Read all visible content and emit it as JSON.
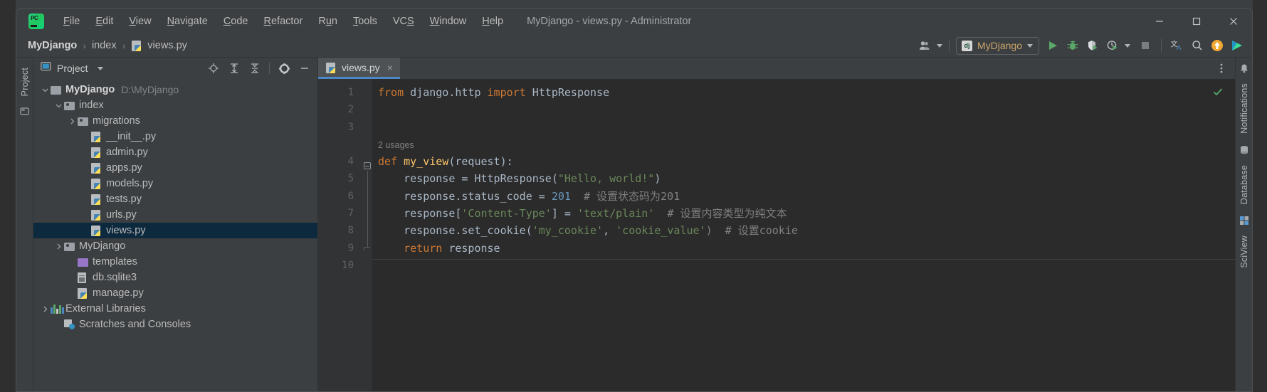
{
  "window": {
    "title": "MyDjango - views.py - Administrator",
    "app_icon": "pycharm-logo",
    "controls": [
      {
        "name": "minimize-button",
        "glyph": "minimize-icon"
      },
      {
        "name": "maximize-button",
        "glyph": "maximize-icon"
      },
      {
        "name": "close-button",
        "glyph": "close-icon"
      }
    ]
  },
  "menu": [
    {
      "label": "File",
      "mnemonic": "F"
    },
    {
      "label": "Edit",
      "mnemonic": "E"
    },
    {
      "label": "View",
      "mnemonic": "V"
    },
    {
      "label": "Navigate",
      "mnemonic": "N"
    },
    {
      "label": "Code",
      "mnemonic": "C"
    },
    {
      "label": "Refactor",
      "mnemonic": "R"
    },
    {
      "label": "Run",
      "mnemonic": "u"
    },
    {
      "label": "Tools",
      "mnemonic": "T"
    },
    {
      "label": "VCS",
      "mnemonic": "S"
    },
    {
      "label": "Window",
      "mnemonic": "W"
    },
    {
      "label": "Help",
      "mnemonic": "H"
    }
  ],
  "breadcrumb": {
    "items": [
      {
        "label": "MyDjango",
        "icon": null,
        "root": true
      },
      {
        "label": "index",
        "icon": null,
        "root": false
      },
      {
        "label": "views.py",
        "icon": "python-file-icon",
        "root": false
      }
    ],
    "separator": "›"
  },
  "toolbar": {
    "collaborate_icon": "user-group-icon",
    "run_config": {
      "label": "MyDjango",
      "icon": "django-icon"
    },
    "actions": [
      {
        "name": "run-button",
        "icon": "run-icon",
        "color": "#59a869"
      },
      {
        "name": "debug-button",
        "icon": "debug-bug-icon",
        "color": "#59a869"
      },
      {
        "name": "run-with-coverage-button",
        "icon": "coverage-icon",
        "color": "#59a869"
      },
      {
        "name": "profile-button",
        "icon": "profiler-icon",
        "color": "#59a869"
      },
      {
        "name": "stop-button",
        "icon": "stop-icon",
        "color": "#7a7e80"
      },
      {
        "name": "translate-button",
        "icon": "translate-icon",
        "color": "#bbbbbb"
      },
      {
        "name": "search-everywhere-button",
        "icon": "search-icon",
        "color": "#bbbbbb"
      },
      {
        "name": "update-button",
        "icon": "update-arrow-icon",
        "color": "#f0a732"
      },
      {
        "name": "plugin-button",
        "icon": "play-plugin-icon",
        "color": "#3ddc97"
      }
    ]
  },
  "left_strip": {
    "tabs": [
      {
        "label": "Project",
        "name": "tool-window-project"
      }
    ],
    "icon": "structure-icon"
  },
  "right_strip": {
    "tabs": [
      {
        "label": "Notifications",
        "name": "tool-window-notifications",
        "icon": "bell-icon"
      },
      {
        "label": "Database",
        "name": "tool-window-database",
        "icon": "database-icon"
      },
      {
        "label": "SciView",
        "name": "tool-window-sciview",
        "icon": "sciview-icon"
      }
    ]
  },
  "project_panel": {
    "title": "Project",
    "header_icons": [
      {
        "name": "select-opened-file-icon",
        "glyph": "target-icon"
      },
      {
        "name": "expand-all-icon",
        "glyph": "expand-icon"
      },
      {
        "name": "collapse-all-icon",
        "glyph": "collapse-icon"
      },
      {
        "name": "settings-gear-icon",
        "glyph": "gear-icon"
      },
      {
        "name": "hide-panel-icon",
        "glyph": "minus-icon"
      }
    ],
    "tree": [
      {
        "label": "MyDjango",
        "path": "D:\\MyDjango",
        "icon": "folder-icon",
        "indent": 0,
        "twisty": "expanded",
        "bold": true,
        "selected": false
      },
      {
        "label": "index",
        "path": "",
        "icon": "source-folder-icon",
        "indent": 1,
        "twisty": "expanded",
        "bold": false,
        "selected": false
      },
      {
        "label": "migrations",
        "path": "",
        "icon": "source-folder-icon",
        "indent": 2,
        "twisty": "collapsed",
        "bold": false,
        "selected": false
      },
      {
        "label": "__init__.py",
        "path": "",
        "icon": "python-file-icon",
        "indent": 3,
        "twisty": "none",
        "bold": false,
        "selected": false
      },
      {
        "label": "admin.py",
        "path": "",
        "icon": "python-file-icon",
        "indent": 3,
        "twisty": "none",
        "bold": false,
        "selected": false
      },
      {
        "label": "apps.py",
        "path": "",
        "icon": "python-file-icon",
        "indent": 3,
        "twisty": "none",
        "bold": false,
        "selected": false
      },
      {
        "label": "models.py",
        "path": "",
        "icon": "python-file-icon",
        "indent": 3,
        "twisty": "none",
        "bold": false,
        "selected": false
      },
      {
        "label": "tests.py",
        "path": "",
        "icon": "python-file-icon",
        "indent": 3,
        "twisty": "none",
        "bold": false,
        "selected": false
      },
      {
        "label": "urls.py",
        "path": "",
        "icon": "python-file-icon",
        "indent": 3,
        "twisty": "none",
        "bold": false,
        "selected": false
      },
      {
        "label": "views.py",
        "path": "",
        "icon": "python-file-icon",
        "indent": 3,
        "twisty": "none",
        "bold": false,
        "selected": true
      },
      {
        "label": "MyDjango",
        "path": "",
        "icon": "source-folder-icon",
        "indent": 1,
        "twisty": "collapsed",
        "bold": false,
        "selected": false
      },
      {
        "label": "templates",
        "path": "",
        "icon": "templates-folder-icon",
        "indent": 2,
        "twisty": "none",
        "bold": false,
        "selected": false
      },
      {
        "label": "db.sqlite3",
        "path": "",
        "icon": "database-file-icon",
        "indent": 2,
        "twisty": "none",
        "bold": false,
        "selected": false
      },
      {
        "label": "manage.py",
        "path": "",
        "icon": "python-file-icon",
        "indent": 2,
        "twisty": "none",
        "bold": false,
        "selected": false
      },
      {
        "label": "External Libraries",
        "path": "",
        "icon": "libraries-icon",
        "indent": 0,
        "twisty": "collapsed",
        "bold": false,
        "selected": false
      },
      {
        "label": "Scratches and Consoles",
        "path": "",
        "icon": "scratches-icon",
        "indent": 1,
        "twisty": "none",
        "bold": false,
        "selected": false
      }
    ]
  },
  "editor": {
    "tabs": [
      {
        "label": "views.py",
        "icon": "python-file-icon",
        "active": true,
        "close": "×"
      }
    ],
    "options_icon": "more-options-icon",
    "inspection_status": "ok-checkmark",
    "line_numbers": [
      "1",
      "2",
      "3",
      "4",
      "5",
      "6",
      "7",
      "8",
      "9",
      "10"
    ],
    "inlay_hints": [
      {
        "line": 4,
        "text": "2 usages"
      }
    ],
    "lines": [
      {
        "n": 1,
        "tokens": [
          {
            "t": "from ",
            "c": "kw"
          },
          {
            "t": "django.http ",
            "c": "ident"
          },
          {
            "t": "import ",
            "c": "kw"
          },
          {
            "t": "HttpResponse",
            "c": "ident"
          }
        ]
      },
      {
        "n": 2,
        "tokens": []
      },
      {
        "n": 3,
        "tokens": []
      },
      {
        "n": 4,
        "tokens": [
          {
            "t": "def ",
            "c": "kw"
          },
          {
            "t": "my_view",
            "c": "fn"
          },
          {
            "t": "(request):",
            "c": "ident"
          }
        ]
      },
      {
        "n": 5,
        "tokens": [
          {
            "t": "    response = HttpResponse(",
            "c": "ident"
          },
          {
            "t": "\"Hello, world!\"",
            "c": "str"
          },
          {
            "t": ")",
            "c": "ident"
          }
        ]
      },
      {
        "n": 6,
        "tokens": [
          {
            "t": "    response.status_code = ",
            "c": "ident"
          },
          {
            "t": "201",
            "c": "num"
          },
          {
            "t": "  # 设置状态码为201",
            "c": "cmt"
          }
        ]
      },
      {
        "n": 7,
        "tokens": [
          {
            "t": "    response[",
            "c": "ident"
          },
          {
            "t": "'Content-Type'",
            "c": "str"
          },
          {
            "t": "] = ",
            "c": "ident"
          },
          {
            "t": "'text/plain'",
            "c": "str"
          },
          {
            "t": "  # 设置内容类型为纯文本",
            "c": "cmt"
          }
        ]
      },
      {
        "n": 8,
        "tokens": [
          {
            "t": "    response.set_cookie(",
            "c": "ident"
          },
          {
            "t": "'my_cookie'",
            "c": "str"
          },
          {
            "t": ", ",
            "c": "ident"
          },
          {
            "t": "'cookie_value'",
            "c": "str"
          },
          {
            "t": ")  # 设置cookie",
            "c": "cmt"
          }
        ]
      },
      {
        "n": 9,
        "tokens": [
          {
            "t": "    ",
            "c": "ident"
          },
          {
            "t": "return ",
            "c": "kw"
          },
          {
            "t": "response",
            "c": "ident"
          }
        ]
      },
      {
        "n": 10,
        "tokens": []
      }
    ]
  },
  "colors": {
    "background": "#3c3f41",
    "editor_bg": "#2b2b2b",
    "gutter_bg": "#313335",
    "selection": "#0d293e",
    "tab_active_underline": "#4a88c7",
    "keyword": "#cc7832",
    "string": "#6a8759",
    "number": "#6897bb",
    "function": "#ffc66d",
    "comment": "#808080",
    "identifier": "#a9b7c6",
    "accent_green": "#59a869",
    "accent_orange": "#f0a732"
  }
}
